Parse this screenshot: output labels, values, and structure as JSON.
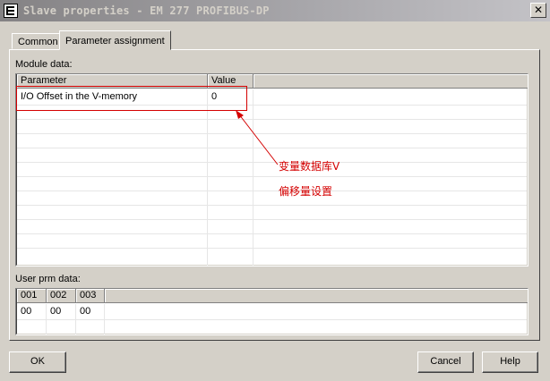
{
  "window": {
    "title": "Slave properties - EM 277 PROFIBUS-DP",
    "close_glyph": "✕"
  },
  "tabs": [
    {
      "label": "Common"
    },
    {
      "label": "Parameter assignment"
    }
  ],
  "module": {
    "label": "Module data:",
    "columns": [
      "Parameter",
      "Value"
    ],
    "rows": [
      {
        "parameter": "I/O Offset in the V-memory",
        "value": "0"
      }
    ]
  },
  "annotation": {
    "line1": "变量数据库V",
    "line2": "偏移量设置",
    "color": "#d40000"
  },
  "user_prm": {
    "label": "User prm data:",
    "columns": [
      "001",
      "002",
      "003"
    ],
    "values": [
      "00",
      "00",
      "00"
    ]
  },
  "buttons": {
    "ok": "OK",
    "cancel": "Cancel",
    "help": "Help"
  }
}
